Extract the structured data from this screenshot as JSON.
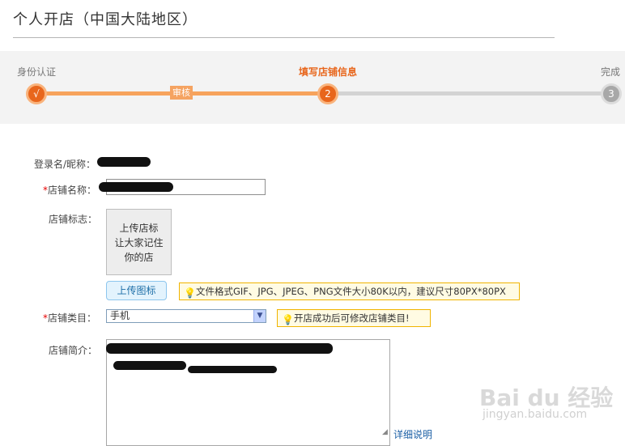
{
  "page": {
    "title": "个人开店（中国大陆地区）"
  },
  "steps": {
    "step1_label": "身份认证",
    "step1_mark": "√",
    "sub_badge": "审核",
    "step2_label": "填写店铺信息",
    "step2_mark": "2",
    "step3_label": "完成",
    "step3_mark": "3"
  },
  "form": {
    "login_label": "登录名/昵称：",
    "shop_name_label": "店铺名称：",
    "shop_name_input_value": "",
    "shop_logo_label": "店铺标志：",
    "logo_placeholder_line1": "上传店标",
    "logo_placeholder_line2": "让大家记住",
    "logo_placeholder_line3": "你的店",
    "upload_button": "上传图标",
    "logo_tip": "文件格式GIF、JPG、JPEG、PNG文件大小80K以内，建议尺寸80PX*80PX",
    "category_label": "店铺类目：",
    "category_value": "手机",
    "category_tip": "开店成功后可修改店铺类目!",
    "intro_label": "店铺简介：",
    "detail_link": "详细说明",
    "required_mark": "*"
  },
  "watermark": {
    "brand": "Bai du 经验",
    "url": "jingyan.baidu.com"
  },
  "colors": {
    "accent": "#e8661c",
    "accent_light": "#f7a35c",
    "tip_border": "#f0b400",
    "link": "#1b5fa5"
  }
}
